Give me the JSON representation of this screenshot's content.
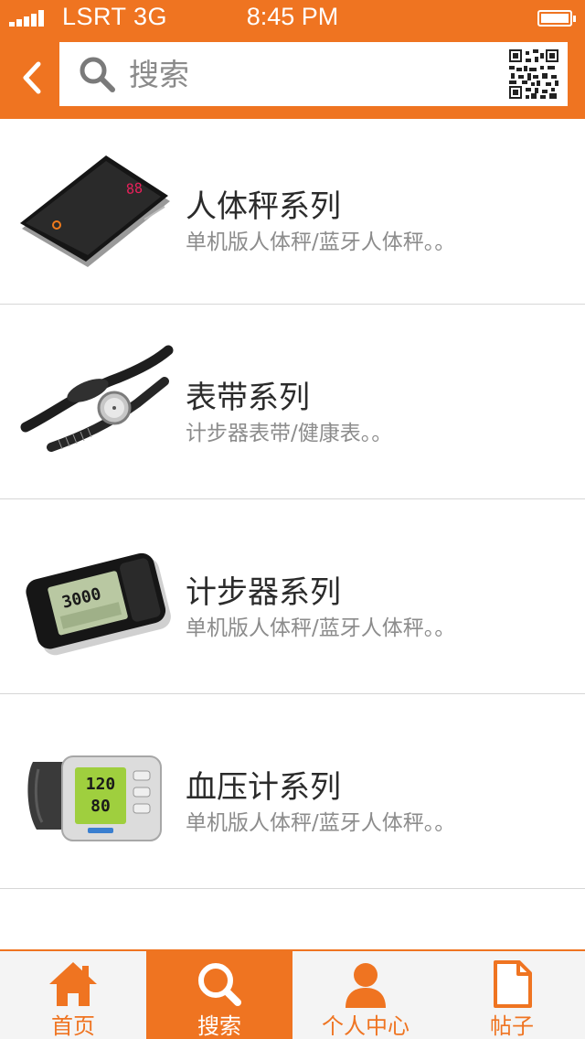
{
  "status_bar": {
    "carrier": "LSRT 3G",
    "time": "8:45 PM"
  },
  "header": {
    "back_icon": "chevron-left-icon",
    "search": {
      "placeholder": "搜索",
      "value": "",
      "icon": "search-icon"
    },
    "qr_icon": "qr-code-icon"
  },
  "products": [
    {
      "title": "人体秤系列",
      "subtitle": "单机版人体秤/蓝牙人体秤。。",
      "image": "body-scale-image"
    },
    {
      "title": "表带系列",
      "subtitle": "计步器表带/健康表。。",
      "image": "watch-band-image"
    },
    {
      "title": "计步器系列",
      "subtitle": "单机版人体秤/蓝牙人体秤。。",
      "image": "pedometer-image"
    },
    {
      "title": "血压计系列",
      "subtitle": "单机版人体秤/蓝牙人体秤。。",
      "image": "blood-pressure-monitor-image"
    }
  ],
  "product_images": {
    "scale_display": "88",
    "pedometer_display": "3000",
    "bp_display_top": "120",
    "bp_display_bottom": "80"
  },
  "tabs": [
    {
      "label": "首页",
      "icon": "home-icon",
      "active": false
    },
    {
      "label": "搜索",
      "icon": "search-icon",
      "active": true
    },
    {
      "label": "个人中心",
      "icon": "user-icon",
      "active": false
    },
    {
      "label": "帖子",
      "icon": "document-icon",
      "active": false
    }
  ],
  "colors": {
    "accent": "#ef7421",
    "tab_bar_bg": "#f4f4f4",
    "divider": "#d6d6d6"
  }
}
